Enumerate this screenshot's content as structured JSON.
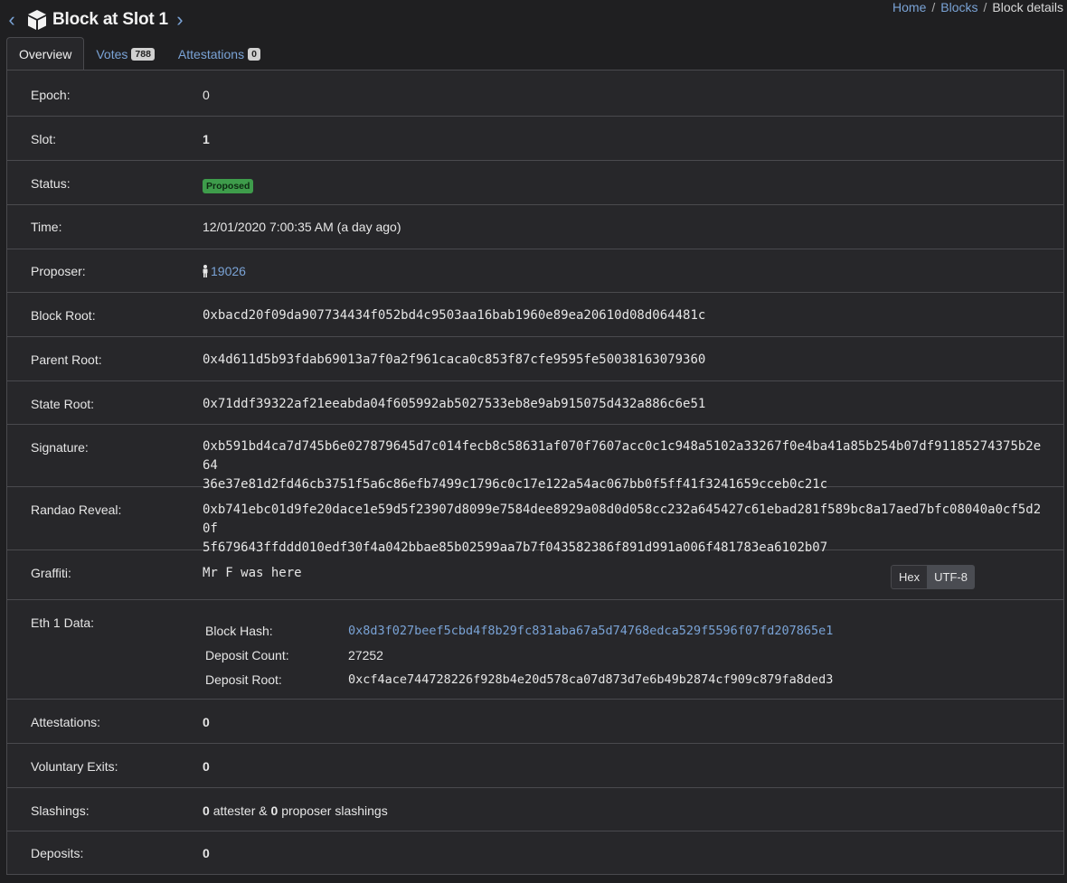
{
  "header": {
    "prev_icon": "chevron-left-icon",
    "next_icon": "chevron-right-icon",
    "title_icon": "cube-icon",
    "title": "Block at Slot 1"
  },
  "breadcrumb": {
    "items": [
      "Home",
      "Blocks",
      "Block details"
    ],
    "separator": "/"
  },
  "tabs": [
    {
      "label": "Overview",
      "badge": null
    },
    {
      "label": "Votes",
      "badge": "788"
    },
    {
      "label": "Attestations",
      "badge": "0"
    }
  ],
  "overview": {
    "epoch": {
      "label": "Epoch:",
      "value": "0"
    },
    "slot": {
      "label": "Slot:",
      "value": "1"
    },
    "status": {
      "label": "Status:",
      "value": "Proposed"
    },
    "time": {
      "label": "Time:",
      "value": "12/01/2020 7:00:35 AM (a day ago)"
    },
    "proposer": {
      "label": "Proposer:",
      "value": "19026",
      "icon": "person-icon"
    },
    "block_root": {
      "label": "Block Root:",
      "value": "0xbacd20f09da907734434f052bd4c9503aa16bab1960e89ea20610d08d064481c"
    },
    "parent_root": {
      "label": "Parent Root:",
      "value": "0x4d611d5b93fdab69013a7f0a2f961caca0c853f87cfe9595fe50038163079360"
    },
    "state_root": {
      "label": "State Root:",
      "value": "0x71ddf39322af21eeabda04f605992ab5027533eb8e9ab915075d432a886c6e51"
    },
    "signature": {
      "label": "Signature:",
      "line1": "0xb591bd4ca7d745b6e027879645d7c014fecb8c58631af070f7607acc0c1c948a5102a33267f0e4ba41a85b254b07df91185274375b2e64",
      "line2": "36e37e81d2fd46cb3751f5a6c86efb7499c1796c0c17e122a54ac067bb0f5ff41f3241659cceb0c21c"
    },
    "randao": {
      "label": "Randao Reveal:",
      "line1": "0xb741ebc01d9fe20dace1e59d5f23907d8099e7584dee8929a08d0d058cc232a645427c61ebad281f589bc8a17aed7bfc08040a0cf5d20f",
      "line2": "5f679643ffddd010edf30f4a042bbae85b02599aa7b7f043582386f891d991a006f481783ea6102b07"
    },
    "graffiti": {
      "label": "Graffiti:",
      "value": "Mr F was here",
      "toggle": [
        "Hex",
        "UTF-8"
      ],
      "active_toggle": "UTF-8"
    },
    "eth1": {
      "label": "Eth 1 Data:",
      "block_hash_label": "Block Hash:",
      "block_hash": "0x8d3f027beef5cbd4f8b29fc831aba67a5d74768edca529f5596f07fd207865e1",
      "deposit_count_label": "Deposit Count:",
      "deposit_count": "27252",
      "deposit_root_label": "Deposit Root:",
      "deposit_root": "0xcf4ace744728226f928b4e20d578ca07d873d7e6b49b2874cf909c879fa8ded3"
    },
    "attestations": {
      "label": "Attestations:",
      "value": "0"
    },
    "voluntary_exits": {
      "label": "Voluntary Exits:",
      "value": "0"
    },
    "slashings": {
      "label": "Slashings:",
      "attester_count": "0",
      "attester_text": "attester &",
      "proposer_count": "0",
      "proposer_text": "proposer slashings"
    },
    "deposits": {
      "label": "Deposits:",
      "value": "0"
    }
  },
  "colors": {
    "background": "#1f1f21",
    "panel": "#27272a",
    "link": "#7aa3d6",
    "status_green": "#3e9c4b"
  }
}
